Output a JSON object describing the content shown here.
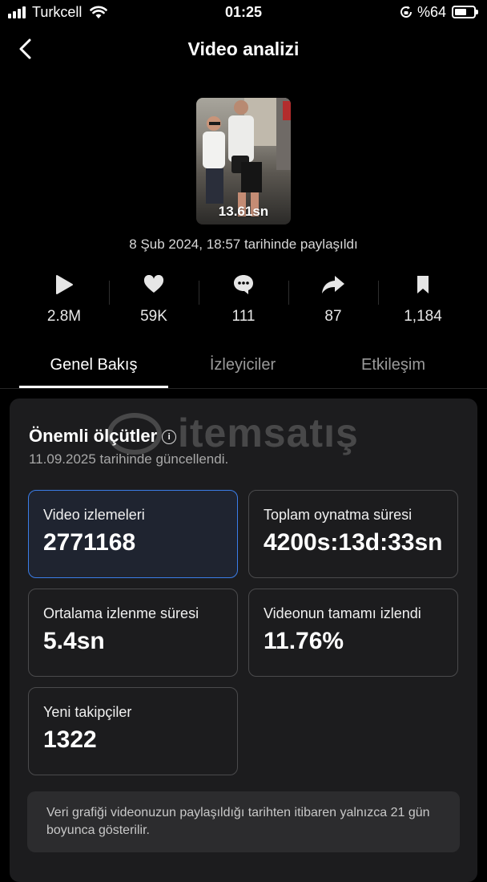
{
  "status_bar": {
    "carrier": "Turkcell",
    "time": "01:25",
    "battery_text": "%64",
    "battery_level": 0.64
  },
  "header": {
    "title": "Video analizi",
    "back_icon": "chevron-left-icon"
  },
  "video": {
    "duration": "13.61sn",
    "posted_text": "8 Şub 2024, 18:57 tarihinde paylaşıldı"
  },
  "stats": [
    {
      "icon": "play-icon",
      "value": "2.8M"
    },
    {
      "icon": "heart-icon",
      "value": "59K"
    },
    {
      "icon": "comment-icon",
      "value": "111"
    },
    {
      "icon": "share-icon",
      "value": "87"
    },
    {
      "icon": "bookmark-icon",
      "value": "1,184"
    }
  ],
  "tabs": [
    {
      "label": "Genel Bakış",
      "active": true
    },
    {
      "label": "İzleyiciler",
      "active": false
    },
    {
      "label": "Etkileşim",
      "active": false
    }
  ],
  "metrics": {
    "title": "Önemli ölçütler",
    "updated": "11.09.2025 tarihinde güncellendi.",
    "cards": [
      {
        "label": "Video izlemeleri",
        "value": "2771168",
        "selected": true
      },
      {
        "label": "Toplam oynatma süresi",
        "value": "4200s:13d:33sn",
        "selected": false
      },
      {
        "label": "Ortalama izlenme süresi",
        "value": "5.4sn",
        "selected": false
      },
      {
        "label": "Videonun tamamı izlendi",
        "value": "11.76%",
        "selected": false
      },
      {
        "label": "Yeni takipçiler",
        "value": "1322",
        "selected": false
      }
    ],
    "note": "Veri grafiği videonuzun paylaşıldığı tarihten itibaren yalnızca 21 gün boyunca gösterilir."
  },
  "watermark": {
    "text": "itemsatış"
  },
  "colors": {
    "accent": "#3b7de8",
    "background": "#000000",
    "panel": "#1c1c1e"
  }
}
